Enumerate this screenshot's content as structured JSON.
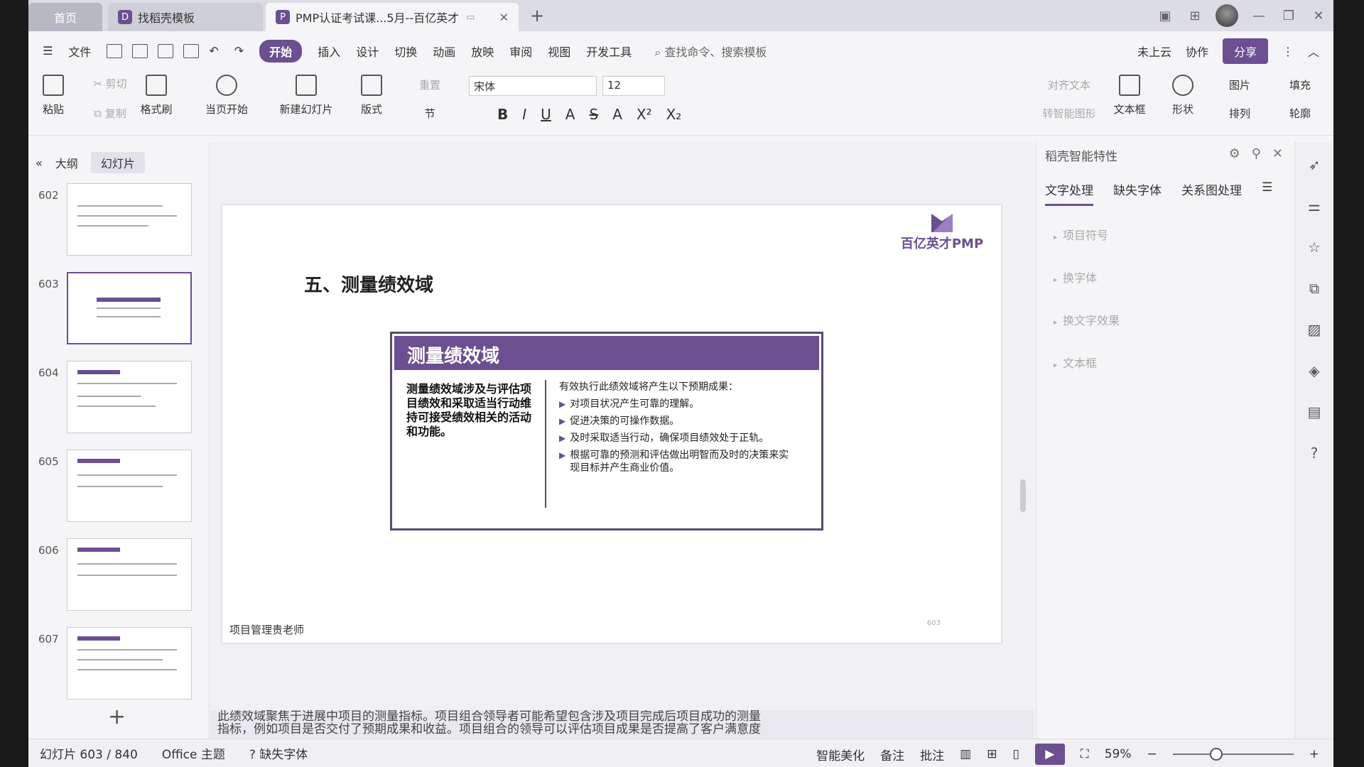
{
  "titlebar": {
    "tab_home": "首页",
    "tab_templates": "找稻壳模板",
    "tab_doc": "PMP认证考试课...5月--百亿英才",
    "add_tab": "+",
    "close": "✕"
  },
  "menubar": {
    "file": "文件",
    "tabs": [
      "开始",
      "插入",
      "设计",
      "切换",
      "动画",
      "放映",
      "审阅",
      "视图",
      "开发工具"
    ],
    "search": "查找命令、搜索模板",
    "cloud": "未上云",
    "collab": "协作",
    "share": "分享"
  },
  "ribbon": {
    "paste": "粘贴",
    "cut": "剪切",
    "copy": "复制",
    "format_painter": "格式刷",
    "start_from_current": "当页开始",
    "new_slide": "新建幻灯片",
    "layout": "版式",
    "section": "节",
    "reset": "重置",
    "font": "宋体",
    "size": "12",
    "align_text": "对齐文本",
    "smart_shape": "转智能图形",
    "textbox": "文本框",
    "shape": "形状",
    "picture": "图片",
    "arrange": "排列",
    "fill": "填充",
    "outline": "轮廓"
  },
  "leftpanel": {
    "outline_tab": "大纲",
    "slides_tab": "幻灯片",
    "slide_numbers": [
      "602",
      "603",
      "604",
      "605",
      "606",
      "607"
    ],
    "selected": "603"
  },
  "slide": {
    "title": "五、测量绩效域",
    "logo_text": "百亿英才PMP",
    "box_title": "测量绩效域",
    "box_left": "测量绩效域涉及与评估项目绩效和采取适当行动维持可接受绩效相关的活动和功能。",
    "box_right_intro": "有效执行此绩效域将产生以下预期成果：",
    "bullets": [
      "对项目状况产生可靠的理解。",
      "促进决策的可操作数据。",
      "及时采取适当行动，确保项目绩效处于正轨。",
      "根据可靠的预测和评估做出明智而及时的决策来实现目标并产生商业价值。"
    ],
    "footer": "项目管理贵老师",
    "page_num": "603"
  },
  "notes": {
    "line1": "此绩效域聚焦于进展中项目的测量指标。项目组合领导者可能希望包含涉及项目完成后项目成功的测量",
    "line2": "指标，例如项目是否交付了预期成果和收益。项目组合的领导可以评估项目成果是否提高了客户满意度"
  },
  "rightpanel": {
    "title": "稻壳智能特性",
    "tabs": [
      "文字处理",
      "缺失字体",
      "关系图处理"
    ],
    "items": [
      "项目符号",
      "换字体",
      "换文字效果",
      "文本框"
    ]
  },
  "statusbar": {
    "slide_info": "幻灯片 603 / 840",
    "theme": "Office 主题",
    "missing_font": "缺失字体",
    "beautify": "智能美化",
    "notes": "备注",
    "comment": "批注",
    "zoom": "59%"
  }
}
